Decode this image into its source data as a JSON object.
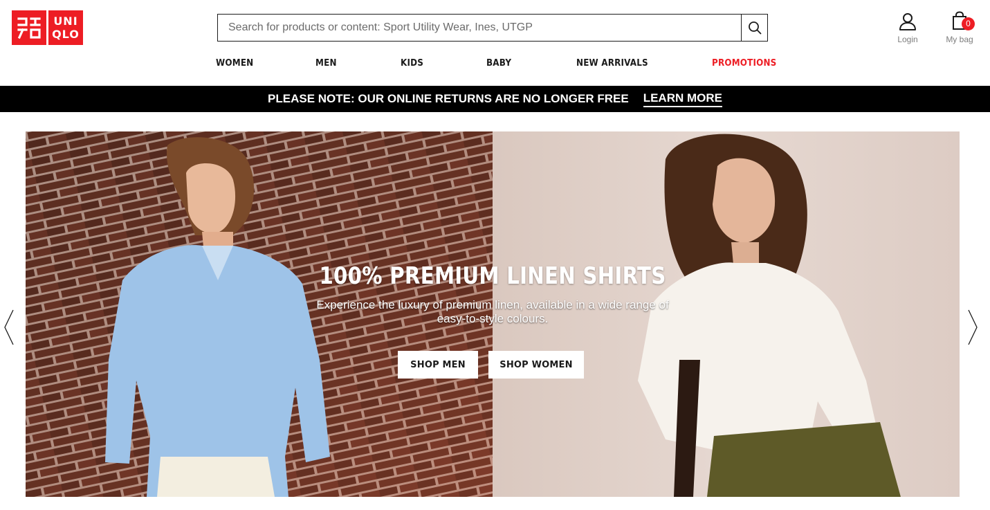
{
  "header": {
    "logo_top": "UNI",
    "logo_bottom": "QLO",
    "search_placeholder": "Search for products or content: Sport Utility Wear, Ines, UTGP",
    "login_label": "Login",
    "bag_label": "My bag",
    "bag_count": "0"
  },
  "nav": {
    "women": "WOMEN",
    "men": "MEN",
    "kids": "KIDS",
    "baby": "BABY",
    "new_arrivals": "NEW ARRIVALS",
    "promotions": "PROMOTIONS"
  },
  "notice": {
    "text": "PLEASE NOTE: OUR ONLINE RETURNS ARE NO LONGER FREE",
    "link": "LEARN MORE"
  },
  "hero": {
    "title": "100% PREMIUM LINEN SHIRTS",
    "subtitle": "Experience the luxury of premium linen, available in a wide range of easy-to-style colours.",
    "shop_men": "SHOP MEN",
    "shop_women": "SHOP WOMEN"
  },
  "icons": {
    "search": "search-icon",
    "account": "user-icon",
    "bag": "shopping-bag-icon",
    "prev": "chevron-left-icon",
    "next": "chevron-right-icon"
  },
  "colors": {
    "brand_red": "#ed1d24",
    "notice_bg": "#000000",
    "text": "#1b1b1b"
  }
}
